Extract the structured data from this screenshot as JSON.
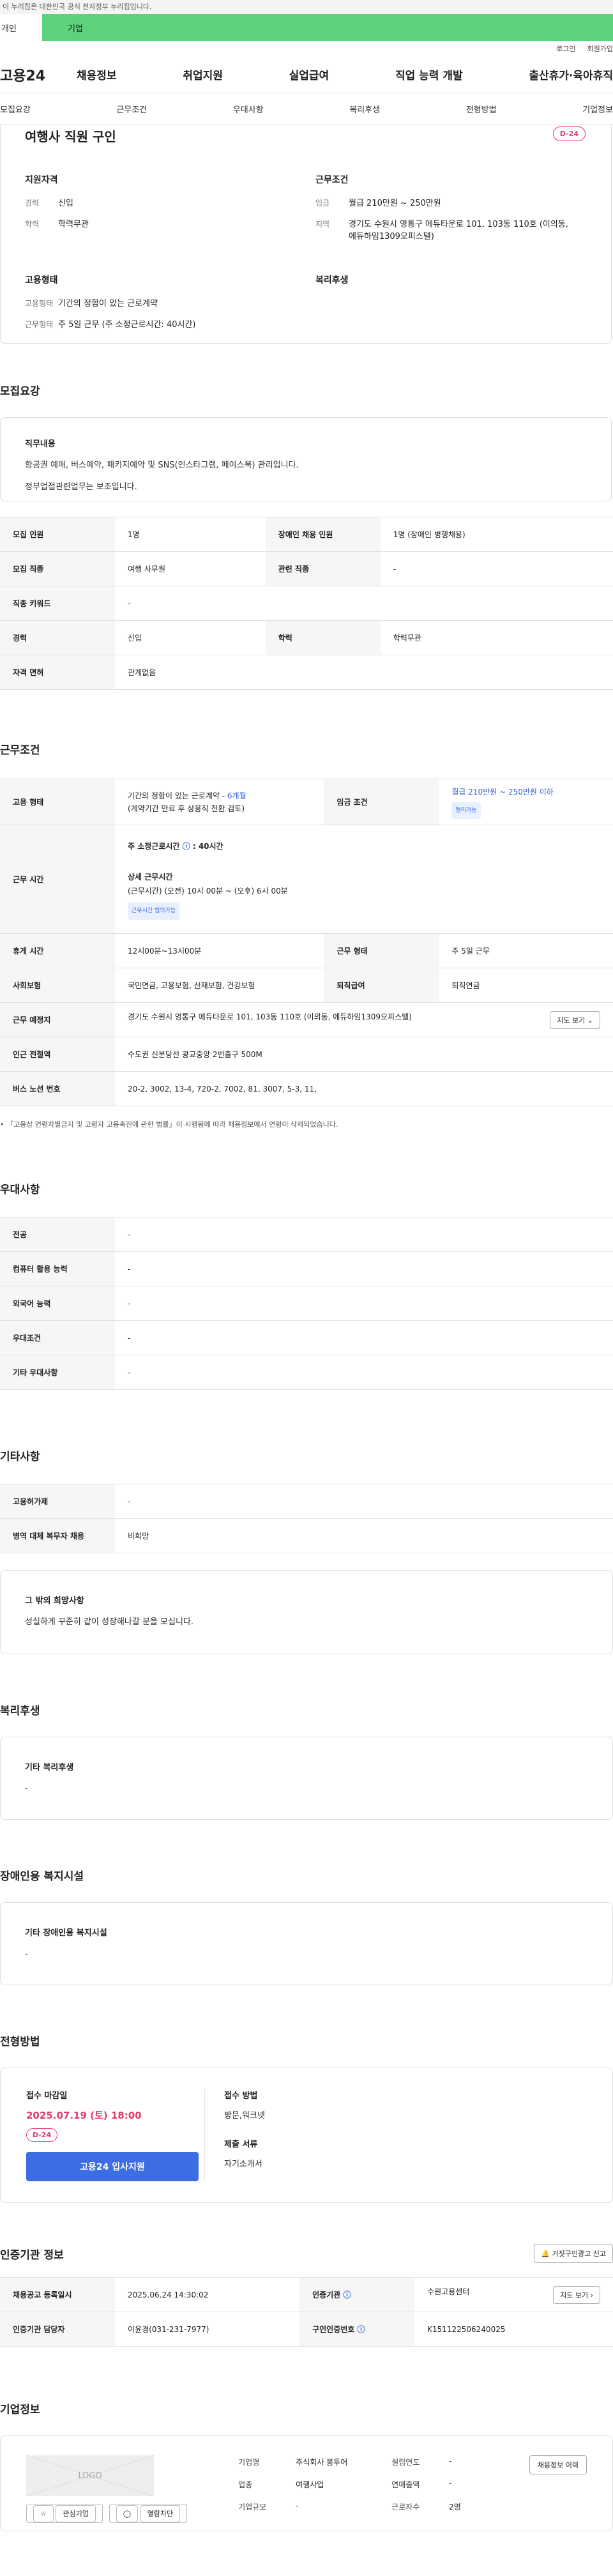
{
  "gov_banner": "이 누리집은 대한민국 공식 전자정부 누리집입니다.",
  "category": {
    "left": "개인",
    "right": "기업"
  },
  "util": {
    "login": "로그인",
    "join": "회원가입"
  },
  "gnb": {
    "logo": "고용24",
    "menu": [
      "채용정보",
      "취업지원",
      "실업급여",
      "직업 능력 개발",
      "출산휴가·육아휴직"
    ]
  },
  "tabs": [
    "모집요강",
    "근무조건",
    "우대사항",
    "복리후생",
    "전형방법",
    "기업정보"
  ],
  "summary": {
    "title": "여행사 직원 구인",
    "dday": "D-24",
    "qual_h": "지원자격",
    "cond_h": "근무조건",
    "type_h": "고용형태",
    "welfare_h": "복리후생",
    "career_k": "경력",
    "career_v": "신입",
    "edu_k": "학력",
    "edu_v": "학력무관",
    "pay_k": "임금",
    "pay_v": "월급 210만원 ~ 250만원",
    "loc_k": "지역",
    "loc_v": "경기도 수원시 영통구 에듀타운로 101, 103동 110호 (이의동, 에듀하임1309오피스텔)",
    "emp_k": "고용형태",
    "emp_v": "기간의 정함이 있는 근로계약",
    "work_k": "근무형태",
    "work_v": "주 5일 근무 (주 소정근로시간: 40시간)"
  },
  "recruit": {
    "title": "모집요강",
    "duty_h": "직무내용",
    "duty_1": "항공권 예매, 버스예약, 패키지예약 및 SNS(인스타그램, 페이스북) 관리입니다.",
    "duty_2": "정부업접관련업무는 보조입니다.",
    "rows": [
      [
        "모집 인원",
        "1명",
        "장애인 채용 인원",
        "1명 (장애인 병행채용)"
      ],
      [
        "모집 직종",
        "여행 사무원",
        "관련 직종",
        "-"
      ],
      [
        "직종 키워드",
        "-"
      ],
      [
        "경력",
        "신입",
        "학력",
        "학력무관"
      ],
      [
        "자격 면허",
        "관계없음"
      ]
    ]
  },
  "conditions": {
    "title": "근무조건",
    "emp_h": "고용 형태",
    "emp_v1": "기간의 정함이 있는 근로계약 - ",
    "emp_v1b": "6개월",
    "emp_v2": "(계약기간 만료 후 상용직 전환 검토)",
    "pay_h": "임금 조건",
    "pay_v": "월급 210만원 ~ 250만원 이하",
    "pay_chip": "협의가능",
    "hours_h": "근무 시간",
    "hours_v1": "주 소정근로시간",
    "hours_v1b": ": 40시간",
    "hours_d_h": "상세 근무시간",
    "hours_d_v": "(근무시간) (오전) 10시 00분 ~ (오후) 6시 00분",
    "hours_chip": "근무시간 협의가능",
    "break_h": "휴게 시간",
    "break_v": "12시00분~13시00분",
    "wform_h": "근무 형태",
    "wform_v": "주 5일 근무",
    "ins_h": "사회보험",
    "ins_v": "국민연금, 고용보험, 산재보험, 건강보험",
    "ret_h": "퇴직급여",
    "ret_v": "퇴직연금",
    "place_h": "근무 예정지",
    "place_v": "경기도 수원시 영통구 에듀타운로 101, 103동 110호 (이의동, 에듀하임1309오피스텔)",
    "map_btn": "지도 보기",
    "sub_h": "인근 전철역",
    "sub_v": "수도권 신분당선 광교중앙 2번출구 500M",
    "bus_h": "버스 노선 번호",
    "bus_v": "20-2, 3002, 13-4, 720-2, 7002, 81, 3007, 5-3, 11,",
    "note": "「고용상 연령차별금지 및 고령자 고용촉진에 관한 법률」이 시행됨에 따라 채용정보에서 연령이 삭제되었습니다."
  },
  "prefer": {
    "title": "우대사항",
    "rows": [
      [
        "전공",
        "-"
      ],
      [
        "컴퓨터 활용 능력",
        "-"
      ],
      [
        "외국어 능력",
        "-"
      ],
      [
        "우대조건",
        "-"
      ],
      [
        "기타 우대사항",
        "-"
      ]
    ]
  },
  "etc": {
    "title": "기타사항",
    "rows": [
      [
        "고용허가제",
        "-"
      ],
      [
        "병역 대체 복무자 채용",
        "비희망"
      ]
    ],
    "wish_h": "그 밖의 희망사항",
    "wish_v": "성실하게 꾸준히 같이 성장해나갈 분을 모십니다."
  },
  "welfare": {
    "title": "복리후생",
    "h": "기타 복리후생",
    "v": "-"
  },
  "disabled": {
    "title": "장애인용 복지시설",
    "h": "기타 장애인용 복지시설",
    "v": "-"
  },
  "selection": {
    "title": "전형방법",
    "deadline_h": "접수 마감일",
    "deadline_v": "2025.07.19 (토) 18:00",
    "dday": "D-24",
    "apply": "고용24 입사지원",
    "method_h": "접수 방법",
    "method_v": "방문,워크넷",
    "docs_h": "제출 서류",
    "docs_v": "자기소개서"
  },
  "agency": {
    "title": "인증기관 정보",
    "report": "거짓구인광고 신고",
    "reg_h": "채용공고 등록일시",
    "reg_v": "2025.06.24 14:30:02",
    "org_h": "인증기관",
    "org_v": "수원고용센터",
    "map": "지도 보기",
    "mgr_h": "인증기관 담당자",
    "mgr_v": "이윤경(031-231-7977)",
    "num_h": "구인인증번호",
    "num_v": "K151122506240025"
  },
  "company": {
    "title": "기업정보",
    "logo": "LOGO",
    "fav": "관심기업",
    "block": "열람차단",
    "history": "채용정보 이력",
    "name_k": "기업명",
    "name_v": "주식회사 봉투어",
    "year_k": "설립연도",
    "year_v": "-",
    "ind_k": "업종",
    "ind_v": "여행사업",
    "sales_k": "연매출액",
    "sales_v": "-",
    "size_k": "기업규모",
    "size_v": "-",
    "emp_k": "근로자수",
    "emp_v": "2명"
  }
}
